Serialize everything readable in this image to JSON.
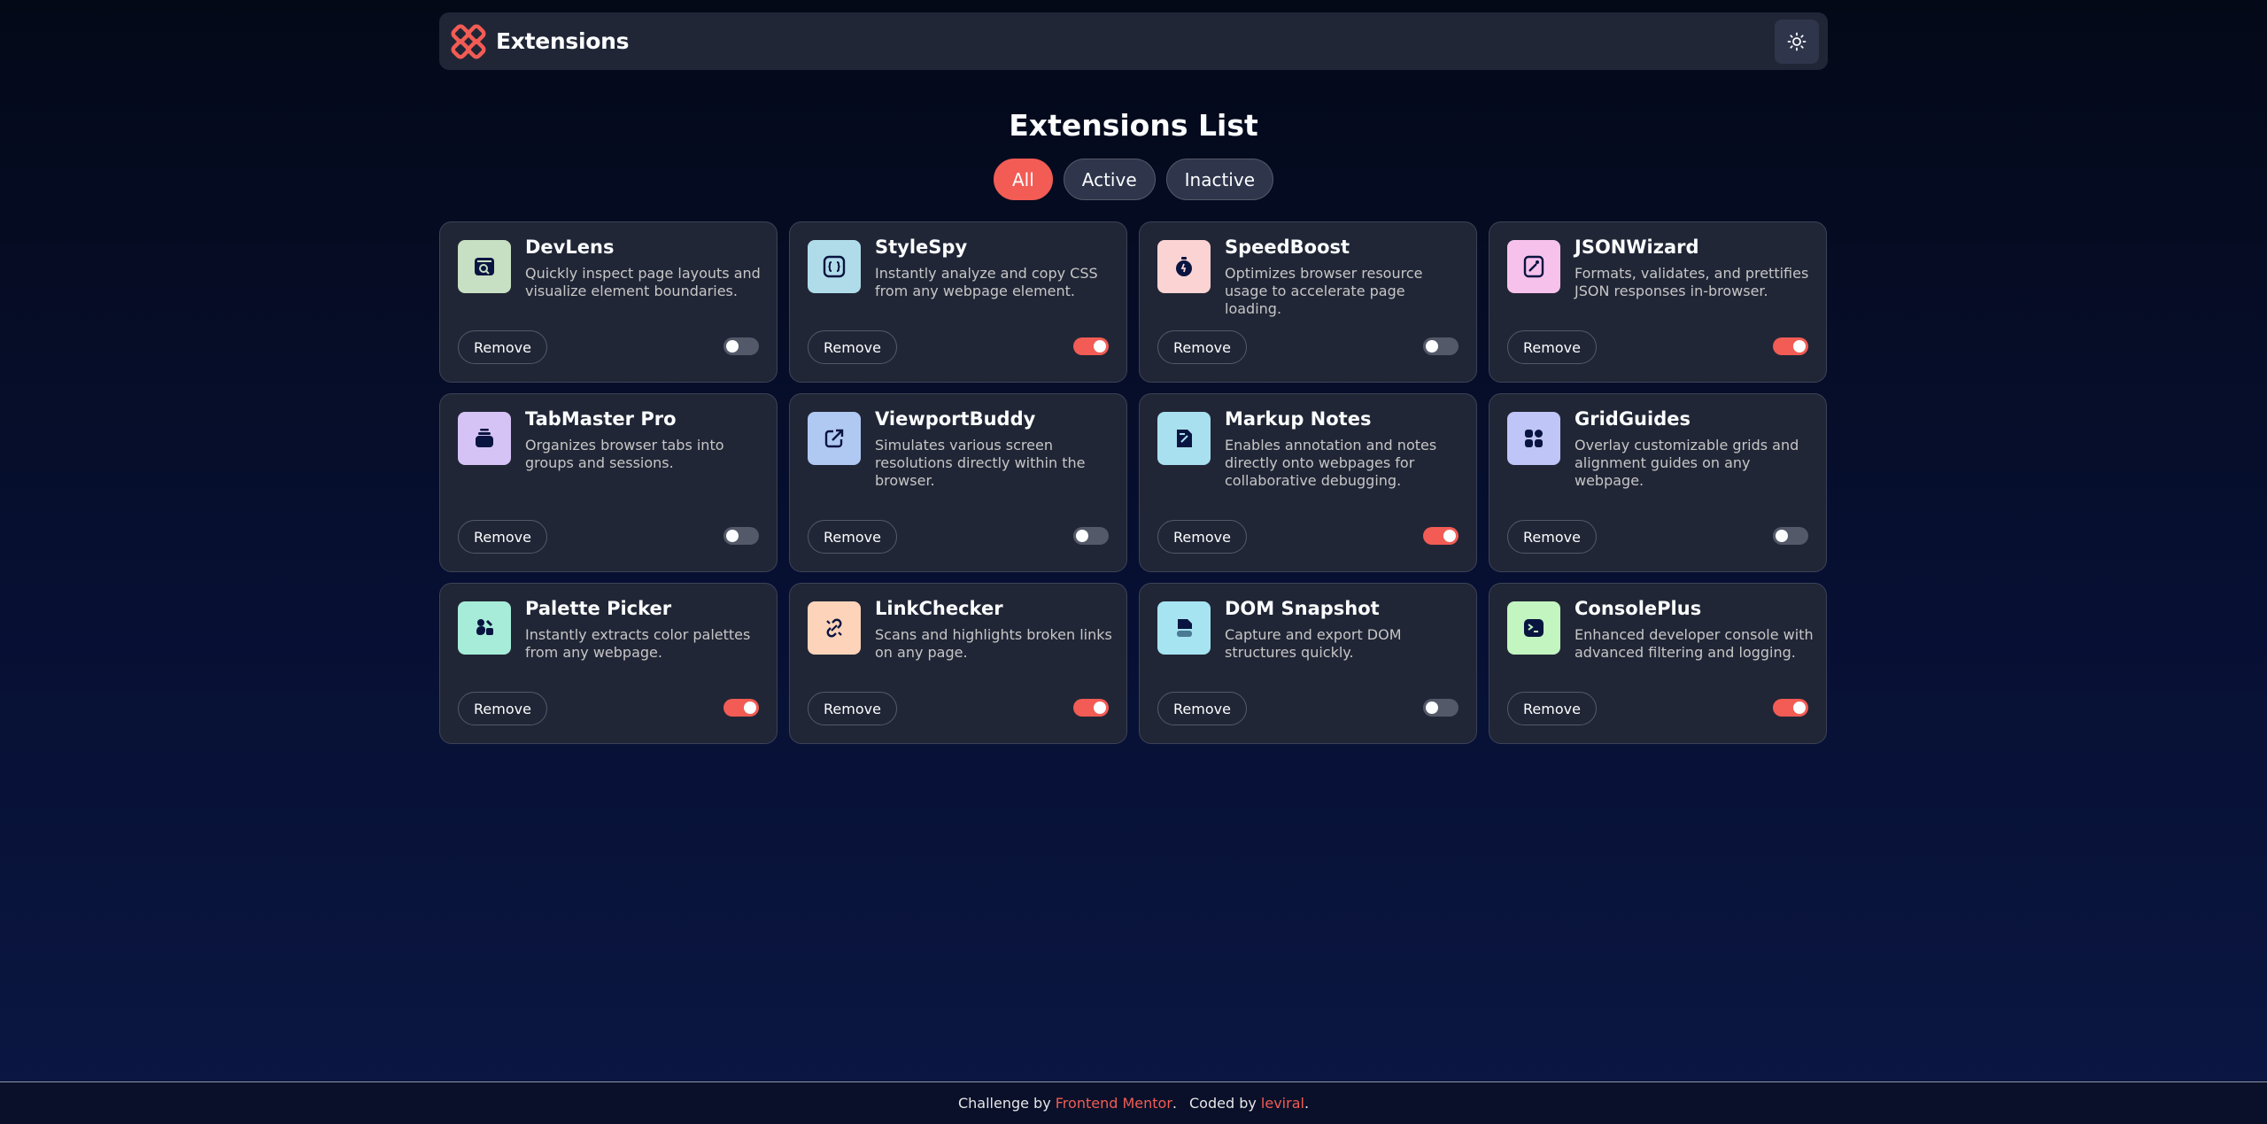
{
  "app": {
    "title": "Extensions"
  },
  "page_title": "Extensions List",
  "filters": [
    {
      "label": "All",
      "selected": true
    },
    {
      "label": "Active",
      "selected": false
    },
    {
      "label": "Inactive",
      "selected": false
    }
  ],
  "remove_label": "Remove",
  "extensions": [
    {
      "name": "DevLens",
      "description": "Quickly inspect page layouts and visualize element boundaries.",
      "icon": "browser-search-icon",
      "color": "#c7dfc2",
      "active": false
    },
    {
      "name": "StyleSpy",
      "description": "Instantly analyze and copy CSS from any webpage element.",
      "icon": "css-braces-icon",
      "color": "#b0dcea",
      "active": true
    },
    {
      "name": "SpeedBoost",
      "description": "Optimizes browser resource usage to accelerate page loading.",
      "icon": "stopwatch-icon",
      "color": "#fcd3d3",
      "active": false
    },
    {
      "name": "JSONWizard",
      "description": "Formats, validates, and prettifies JSON responses in-browser.",
      "icon": "wand-file-icon",
      "color": "#f6c2ec",
      "active": true
    },
    {
      "name": "TabMaster Pro",
      "description": "Organizes browser tabs into groups and sessions.",
      "icon": "tab-stack-icon",
      "color": "#d6c3f5",
      "active": false
    },
    {
      "name": "ViewportBuddy",
      "description": "Simulates various screen resolutions directly within the browser.",
      "icon": "external-link-icon",
      "color": "#b0c9f3",
      "active": false
    },
    {
      "name": "Markup Notes",
      "description": "Enables annotation and notes directly onto webpages for collaborative debugging.",
      "icon": "note-pen-icon",
      "color": "#a9e0ef",
      "active": true
    },
    {
      "name": "GridGuides",
      "description": "Overlay customizable grids and alignment guides on any webpage.",
      "icon": "grid-tiles-icon",
      "color": "#bfc5f7",
      "active": false
    },
    {
      "name": "Palette Picker",
      "description": "Instantly extracts color palettes from any webpage.",
      "icon": "palette-icon",
      "color": "#a7ecd8",
      "active": true
    },
    {
      "name": "LinkChecker",
      "description": "Scans and highlights broken links on any page.",
      "icon": "broken-link-icon",
      "color": "#fdd4ba",
      "active": true
    },
    {
      "name": "DOM Snapshot",
      "description": "Capture and export DOM structures quickly.",
      "icon": "snapshot-icon",
      "color": "#a7e4f1",
      "active": false
    },
    {
      "name": "ConsolePlus",
      "description": "Enhanced developer console with advanced filtering and logging.",
      "icon": "terminal-icon",
      "color": "#c2f5c0",
      "active": true
    }
  ],
  "footer": {
    "challenge_prefix": "Challenge by",
    "challenge_link": "Frontend Mentor",
    "challenge_suffix": ".",
    "coded_prefix": "Coded by",
    "coded_link": "leviral",
    "coded_suffix": "."
  },
  "colors": {
    "accent": "#f25c54",
    "card_bg": "#212636",
    "icon_ink": "#091540"
  }
}
